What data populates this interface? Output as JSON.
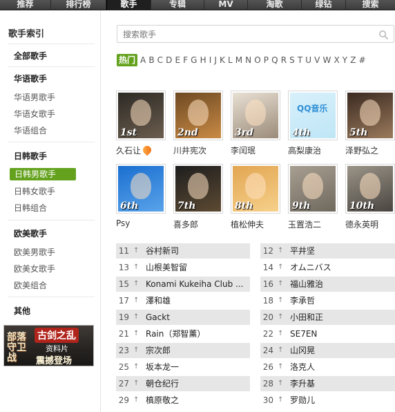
{
  "nav": {
    "tabs": [
      "推荐",
      "排行榜",
      "歌手",
      "专辑",
      "MV",
      "淘歌",
      "绿钻",
      "搜索"
    ]
  },
  "sidebar": {
    "title": "歌手索引",
    "all": "全部歌手",
    "groups": [
      {
        "head": "华语歌手",
        "items": [
          "华语男歌手",
          "华语女歌手",
          "华语组合"
        ]
      },
      {
        "head": "日韩歌手",
        "items": [
          "日韩男歌手",
          "日韩女歌手",
          "日韩组合"
        ]
      },
      {
        "head": "欧美歌手",
        "items": [
          "欧美男歌手",
          "欧美女歌手",
          "欧美组合"
        ]
      }
    ],
    "other": "其他",
    "active_item": "日韩男歌手",
    "banner": {
      "left": "部落守卫战",
      "badge": "古剑之乱",
      "line2": "资料片",
      "line3": "震撼登场"
    }
  },
  "search": {
    "placeholder": "搜索歌手"
  },
  "letter_filter": {
    "hot": "热门",
    "letters": [
      "A",
      "B",
      "C",
      "D",
      "E",
      "F",
      "G",
      "H",
      "I",
      "J",
      "K",
      "L",
      "M",
      "N",
      "O",
      "P",
      "Q",
      "R",
      "S",
      "T",
      "U",
      "V",
      "W",
      "X",
      "Y",
      "Z",
      "#"
    ]
  },
  "top_artists": [
    {
      "rank": "1st",
      "name": "久石让",
      "hot": true,
      "colors": [
        "#2d2a25",
        "#6b5d4e"
      ]
    },
    {
      "rank": "2nd",
      "name": "川井宪次",
      "colors": [
        "#6e4a23",
        "#c98a45"
      ]
    },
    {
      "rank": "3rd",
      "name": "李闰珉",
      "colors": [
        "#e8e0d4",
        "#9b8b79"
      ]
    },
    {
      "rank": "4th",
      "name": "高梨康治",
      "logo": "QQ音乐",
      "colors": [
        "#d8f0fb",
        "#bfe6f6"
      ]
    },
    {
      "rank": "5th",
      "name": "泽野弘之",
      "colors": [
        "#3b2a21",
        "#9a7a5c"
      ]
    },
    {
      "rank": "6th",
      "name": "Psy",
      "colors": [
        "#1a6fd0",
        "#5aa3ea"
      ]
    },
    {
      "rank": "7th",
      "name": "喜多郎",
      "colors": [
        "#1e1e1e",
        "#5c4a32"
      ]
    },
    {
      "rank": "8th",
      "name": "植松伸夫",
      "colors": [
        "#e2a652",
        "#f6d08b"
      ]
    },
    {
      "rank": "9th",
      "name": "玉置浩二",
      "colors": [
        "#a89f92",
        "#6f685d"
      ]
    },
    {
      "rank": "10th",
      "name": "德永英明",
      "colors": [
        "#9a9488",
        "#4a4540"
      ]
    }
  ],
  "chart_list": [
    {
      "num": "11",
      "arrow": "↑",
      "name": "谷村新司"
    },
    {
      "num": "12",
      "arrow": "↑",
      "name": "平井坚"
    },
    {
      "num": "13",
      "arrow": "↑",
      "name": "山根美智留"
    },
    {
      "num": "14",
      "arrow": "↑",
      "name": "オムニバス"
    },
    {
      "num": "15",
      "arrow": "↑",
      "name": "Konami Kukeiha Club ..."
    },
    {
      "num": "16",
      "arrow": "↑",
      "name": "福山雅治"
    },
    {
      "num": "17",
      "arrow": "↑",
      "name": "澤和雄"
    },
    {
      "num": "18",
      "arrow": "↑",
      "name": "李承哲"
    },
    {
      "num": "19",
      "arrow": "↑",
      "name": "Gackt"
    },
    {
      "num": "20",
      "arrow": "↑",
      "name": "小田和正"
    },
    {
      "num": "21",
      "arrow": "↑",
      "name": "Rain（郑智薰）"
    },
    {
      "num": "22",
      "arrow": "↑",
      "name": "SE7EN"
    },
    {
      "num": "23",
      "arrow": "↑",
      "name": "宗次郎"
    },
    {
      "num": "24",
      "arrow": "↑",
      "name": "山冈晃"
    },
    {
      "num": "25",
      "arrow": "↑",
      "name": "坂本龙一"
    },
    {
      "num": "26",
      "arrow": "↑",
      "name": "洛克人"
    },
    {
      "num": "27",
      "arrow": "↑",
      "name": "朝仓纪行"
    },
    {
      "num": "28",
      "arrow": "↑",
      "name": "李升基"
    },
    {
      "num": "29",
      "arrow": "↑",
      "name": "槙原敬之"
    },
    {
      "num": "30",
      "arrow": "↑",
      "name": "罗勋儿"
    }
  ]
}
